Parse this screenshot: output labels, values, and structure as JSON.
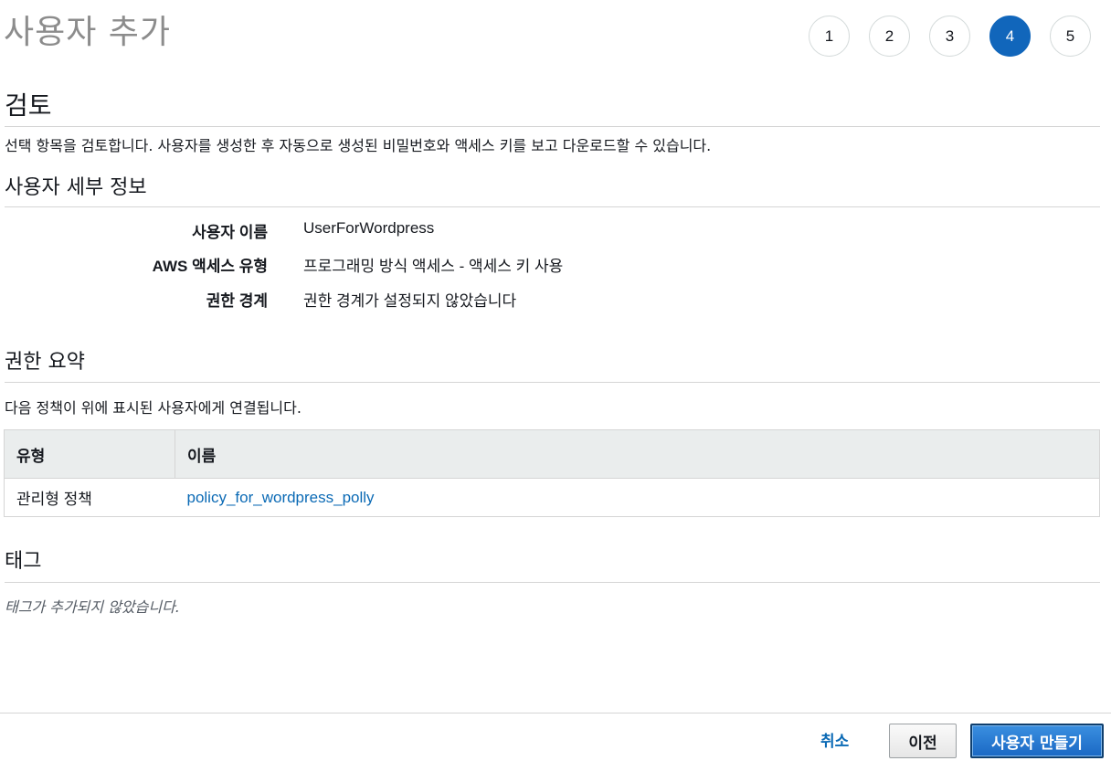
{
  "page": {
    "title": "사용자 추가"
  },
  "steps": [
    "1",
    "2",
    "3",
    "4",
    "5"
  ],
  "current_step": 4,
  "review": {
    "heading": "검토",
    "description": "선택 항목을 검토합니다. 사용자를 생성한 후 자동으로 생성된 비밀번호와 액세스 키를 보고 다운로드할 수 있습니다."
  },
  "user_details": {
    "heading": "사용자 세부 정보",
    "rows": [
      {
        "label": "사용자 이름",
        "value": "UserForWordpress"
      },
      {
        "label": "AWS 액세스 유형",
        "value": "프로그래밍 방식 액세스 - 액세스 키 사용"
      },
      {
        "label": "권한 경계",
        "value": "권한 경계가 설정되지 않았습니다"
      }
    ]
  },
  "permissions": {
    "heading": "권한 요약",
    "description": "다음 정책이 위에 표시된 사용자에게 연결됩니다.",
    "columns": [
      "유형",
      "이름"
    ],
    "rows": [
      {
        "type": "관리형 정책",
        "name": "policy_for_wordpress_polly"
      }
    ]
  },
  "tags": {
    "heading": "태그",
    "empty_text": "태그가 추가되지 않았습니다."
  },
  "footer": {
    "cancel_label": "취소",
    "previous_label": "이전",
    "create_label": "사용자 만들기"
  },
  "colors": {
    "accent": "#1166bb",
    "link": "#0b6ab5"
  }
}
